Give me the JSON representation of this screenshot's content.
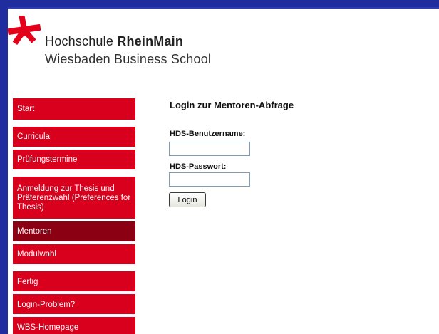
{
  "colors": {
    "frame": "#1f2d9f",
    "nav_background": "#d8001c",
    "nav_active": "#8c0014",
    "logo_star": "#e2001a"
  },
  "logo": {
    "icon": "star-asterisk-icon",
    "line1_prefix": "Hochschule ",
    "line1_bold": "RheinMain",
    "line2": "Wiesbaden Business School"
  },
  "nav": {
    "items": [
      {
        "label": "Start",
        "active": false
      },
      {
        "label": "Curricula",
        "active": false
      },
      {
        "label": "Prüfungstermine",
        "active": false
      },
      {
        "label": "Anmeldung zur Thesis und Präferenzwahl (Preferences for Thesis)",
        "active": false
      },
      {
        "label": "Mentoren",
        "active": true
      },
      {
        "label": "Modulwahl",
        "active": false
      },
      {
        "label": "Fertig",
        "active": false
      },
      {
        "label": "Login-Problem?",
        "active": false
      },
      {
        "label": "WBS-Homepage",
        "active": false
      }
    ]
  },
  "form": {
    "title": "Login zur Mentoren-Abfrage",
    "username_label": "HDS-Benutzername:",
    "username_value": "",
    "password_label": "HDS-Passwort:",
    "password_value": "",
    "login_button": "Login"
  }
}
